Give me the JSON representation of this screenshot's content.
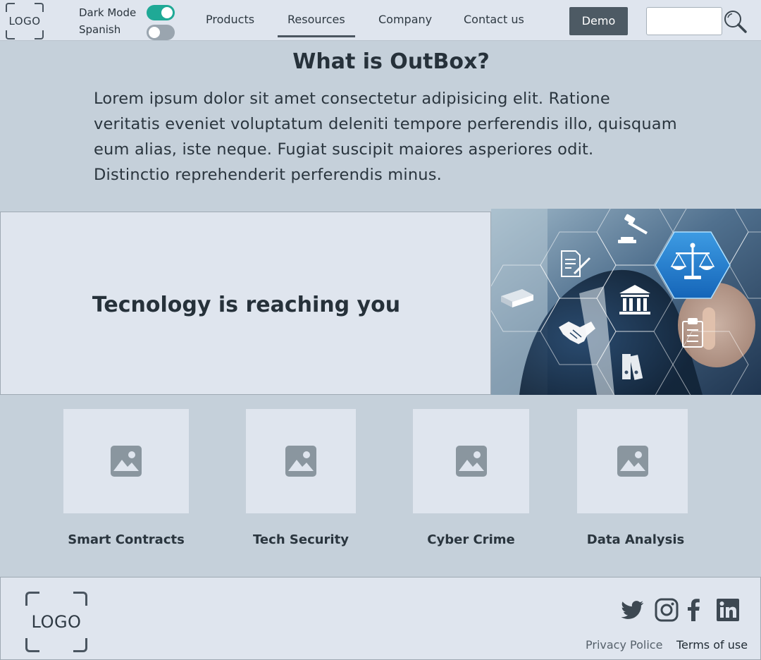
{
  "header": {
    "logo_text": "LOGO",
    "toggles": [
      {
        "label": "Dark Mode",
        "state": "on"
      },
      {
        "label": "Spanish",
        "state": "off"
      }
    ],
    "nav": [
      {
        "label": "Products",
        "active": false
      },
      {
        "label": "Resources",
        "active": true
      },
      {
        "label": "Company",
        "active": false
      },
      {
        "label": "Contact us",
        "active": false
      }
    ],
    "demo_button": "Demo",
    "search": {
      "value": "",
      "placeholder": "",
      "icon": "search-icon"
    },
    "colors": {
      "toggle_on": "#1fa996",
      "toggle_off": "#9aa5af",
      "demo_bg": "#4d5a64"
    }
  },
  "hero": {
    "title": "What is OutBox?",
    "text": "Lorem ipsum dolor sit amet consectetur adipisicing elit. Ratione\nveritatis eveniet voluptatum deleniti tempore perferendis illo, quisquam\n eum alias, iste neque. Fugiat suscipit maiores asperiores odit.\n Distinctio reprehenderit perferendis minus."
  },
  "banner": {
    "text": "Tecnology is reaching you",
    "image": "legal-technology-hexagon-photo"
  },
  "cards": [
    {
      "label": "Smart Contracts",
      "icon": "image-placeholder-icon"
    },
    {
      "label": "Tech Security",
      "icon": "image-placeholder-icon"
    },
    {
      "label": "Cyber Crime",
      "icon": "image-placeholder-icon"
    },
    {
      "label": "Data Analysis",
      "icon": "image-placeholder-icon"
    }
  ],
  "footer": {
    "logo_text": "LOGO",
    "social": [
      "twitter-icon",
      "instagram-icon",
      "facebook-icon",
      "linkedin-icon"
    ],
    "links": [
      {
        "label": "Privacy Police",
        "color": "#56616b"
      },
      {
        "label": "Terms of use",
        "color": "#1f2a33"
      }
    ]
  }
}
